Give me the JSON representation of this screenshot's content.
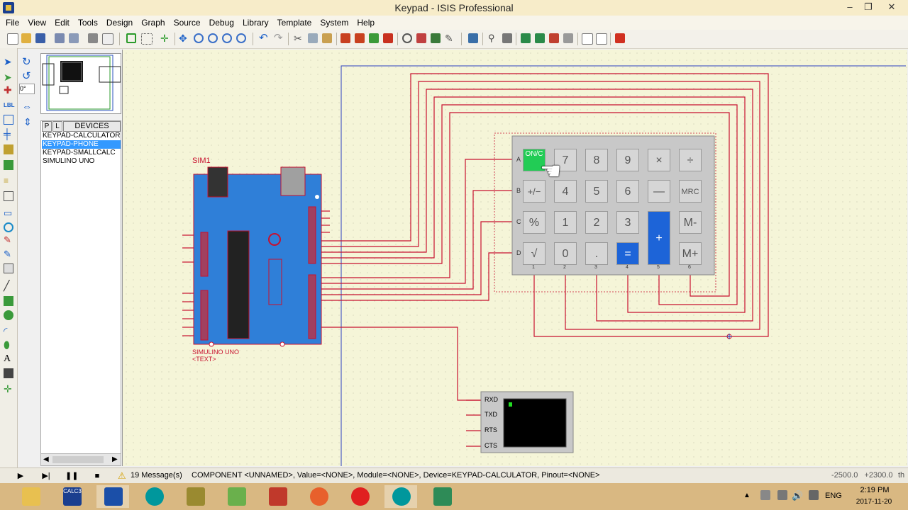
{
  "window": {
    "title": "Keypad - ISIS Professional",
    "controls": {
      "minimize": "–",
      "maximize": "❐",
      "close": "✕"
    }
  },
  "menu": [
    "File",
    "View",
    "Edit",
    "Tools",
    "Design",
    "Graph",
    "Source",
    "Debug",
    "Library",
    "Template",
    "System",
    "Help"
  ],
  "rotation": {
    "value": "0°"
  },
  "devices": {
    "tab_p": "P",
    "tab_l": "L",
    "header": "DEVICES",
    "items": [
      {
        "label": "KEYPAD-CALCULATOR",
        "selected": false
      },
      {
        "label": "KEYPAD-PHONE",
        "selected": true
      },
      {
        "label": "KEYPAD-SMALLCALC",
        "selected": false
      },
      {
        "label": "SIMULINO UNO",
        "selected": false
      }
    ]
  },
  "schematic": {
    "sim_ref": "SIM1",
    "arduino_label": "SIMULINO UNO",
    "arduino_text": "<TEXT>",
    "keypad": {
      "rows": [
        "A",
        "B",
        "C",
        "D"
      ],
      "cols": [
        "1",
        "2",
        "3",
        "4",
        "5",
        "6"
      ],
      "keys": [
        [
          "ON/C",
          "7",
          "8",
          "9",
          "×",
          "÷"
        ],
        [
          "+/−",
          "4",
          "5",
          "6",
          "—",
          "MRC"
        ],
        [
          "%",
          "1",
          "2",
          "3",
          "+",
          "M-"
        ],
        [
          "√",
          "0",
          ".",
          "=",
          "",
          "M+"
        ]
      ]
    },
    "terminal_pins": [
      "RXD",
      "TXD",
      "RTS",
      "CTS"
    ]
  },
  "statusbar": {
    "messages": "19 Message(s)",
    "info": "COMPONENT <UNNAMED>, Value=<NONE>, Module=<NONE>, Device=KEYPAD-CALCULATOR, Pinout=<NONE>",
    "coords": "-2500.0   +2300.0",
    "unit": "th"
  },
  "taskbar": {
    "language": "ENG",
    "time": "2:19 PM",
    "date": "2017-11-20",
    "calc3_label": "CALC3"
  },
  "colors": {
    "wire": "#c8102e",
    "board": "#2f7fd8",
    "keypad_on": "#22cc55",
    "keypad_blue": "#1d64d8"
  }
}
